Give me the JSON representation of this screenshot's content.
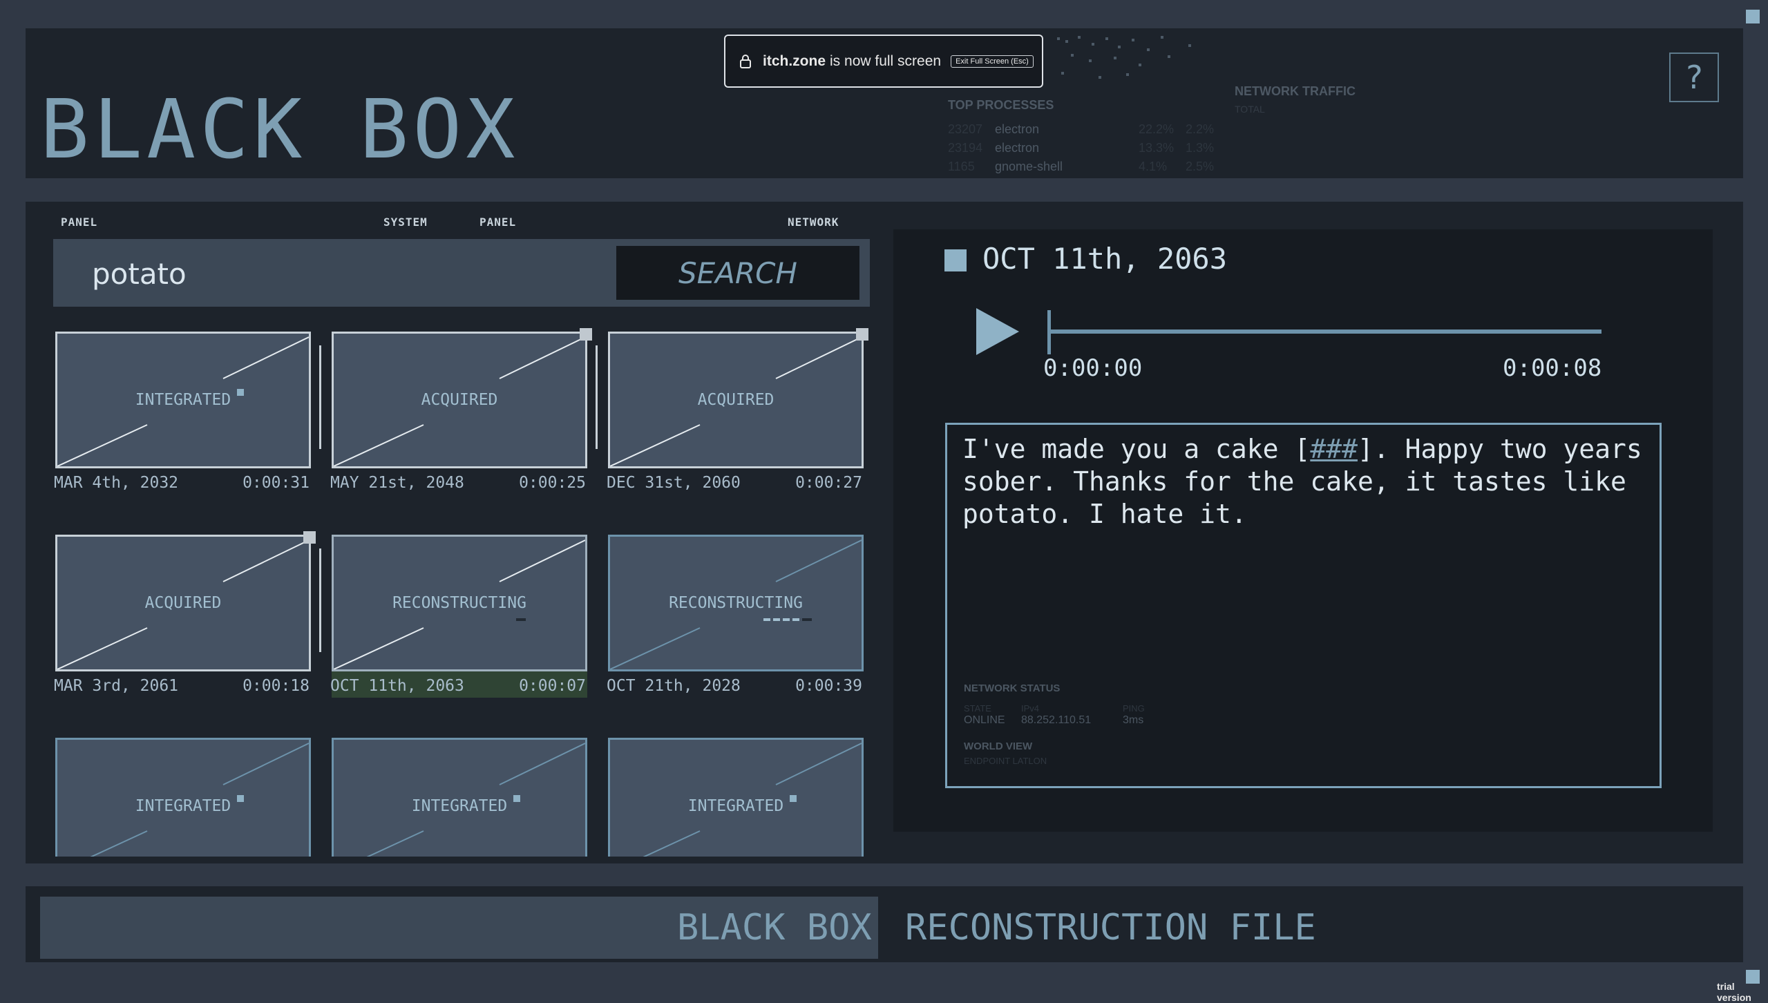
{
  "app": {
    "title": "BLACK BOX",
    "help_label": "?"
  },
  "fullscreen_toast": {
    "domain": "itch.zone",
    "message": "is now full screen",
    "exit_label": "Exit Full Screen (Esc)"
  },
  "header_overlay": {
    "top_processes_label": "TOP PROCESSES",
    "network_traffic_label": "NETWORK TRAFFIC",
    "total_label": "TOTAL",
    "processes": [
      {
        "pid": "23207",
        "name": "electron",
        "cpu": "22.2%",
        "mem": "2.2%"
      },
      {
        "pid": "23194",
        "name": "electron",
        "cpu": "13.3%",
        "mem": "1.3%"
      },
      {
        "pid": "1165",
        "name": "gnome-shell",
        "cpu": "4.1%",
        "mem": "2.5%"
      }
    ]
  },
  "panel_micro_labels": [
    "PANEL",
    "SYSTEM",
    "PANEL",
    "NETWORK"
  ],
  "search": {
    "value": "potato",
    "button_label": "SEARCH"
  },
  "tiles": [
    {
      "state": "INTEGRATED",
      "date": "MAR 4th, 2032",
      "duration": "0:00:31"
    },
    {
      "state": "ACQUIRED",
      "date": "MAY 21st, 2048",
      "duration": "0:00:25"
    },
    {
      "state": "ACQUIRED",
      "date": "DEC 31st, 2060",
      "duration": "0:00:27"
    },
    {
      "state": "ACQUIRED",
      "date": "MAR 3rd, 2061",
      "duration": "0:00:18"
    },
    {
      "state": "RECONSTRUCTING",
      "date": "OCT 11th, 2063",
      "duration": "0:00:07",
      "selected": true
    },
    {
      "state": "RECONSTRUCTING",
      "date": "OCT 21th, 2028",
      "duration": "0:00:39"
    },
    {
      "state": "INTEGRATED",
      "date": "",
      "duration": ""
    },
    {
      "state": "INTEGRATED",
      "date": "",
      "duration": ""
    },
    {
      "state": "INTEGRATED",
      "date": "",
      "duration": ""
    }
  ],
  "player": {
    "date": "OCT 11th, 2063",
    "current_time": "0:00:00",
    "total_time": "0:00:08",
    "progress": 0.0,
    "transcript_before": "I've made you a cake [",
    "transcript_redacted": "###",
    "transcript_after": "]. Happy two years\nsober. Thanks for the cake, it tastes like\npotato. I hate it."
  },
  "network_status": {
    "title": "NETWORK STATUS",
    "state_label": "STATE",
    "ipv4_label": "IPv4",
    "ping_label": "PING",
    "state": "ONLINE",
    "ipv4": "88.252.110.51",
    "ping": "3ms",
    "world_view": "WORLD VIEW",
    "endpoint": "ENDPOINT LATLON"
  },
  "footer": {
    "brand": "BLACK BOX",
    "file_label": "RECONSTRUCTION FILE"
  },
  "watermark": "trial version",
  "colors": {
    "accent": "#8fb2c6",
    "panel": "#1d232b",
    "background": "#303845",
    "tile": "#455263"
  }
}
